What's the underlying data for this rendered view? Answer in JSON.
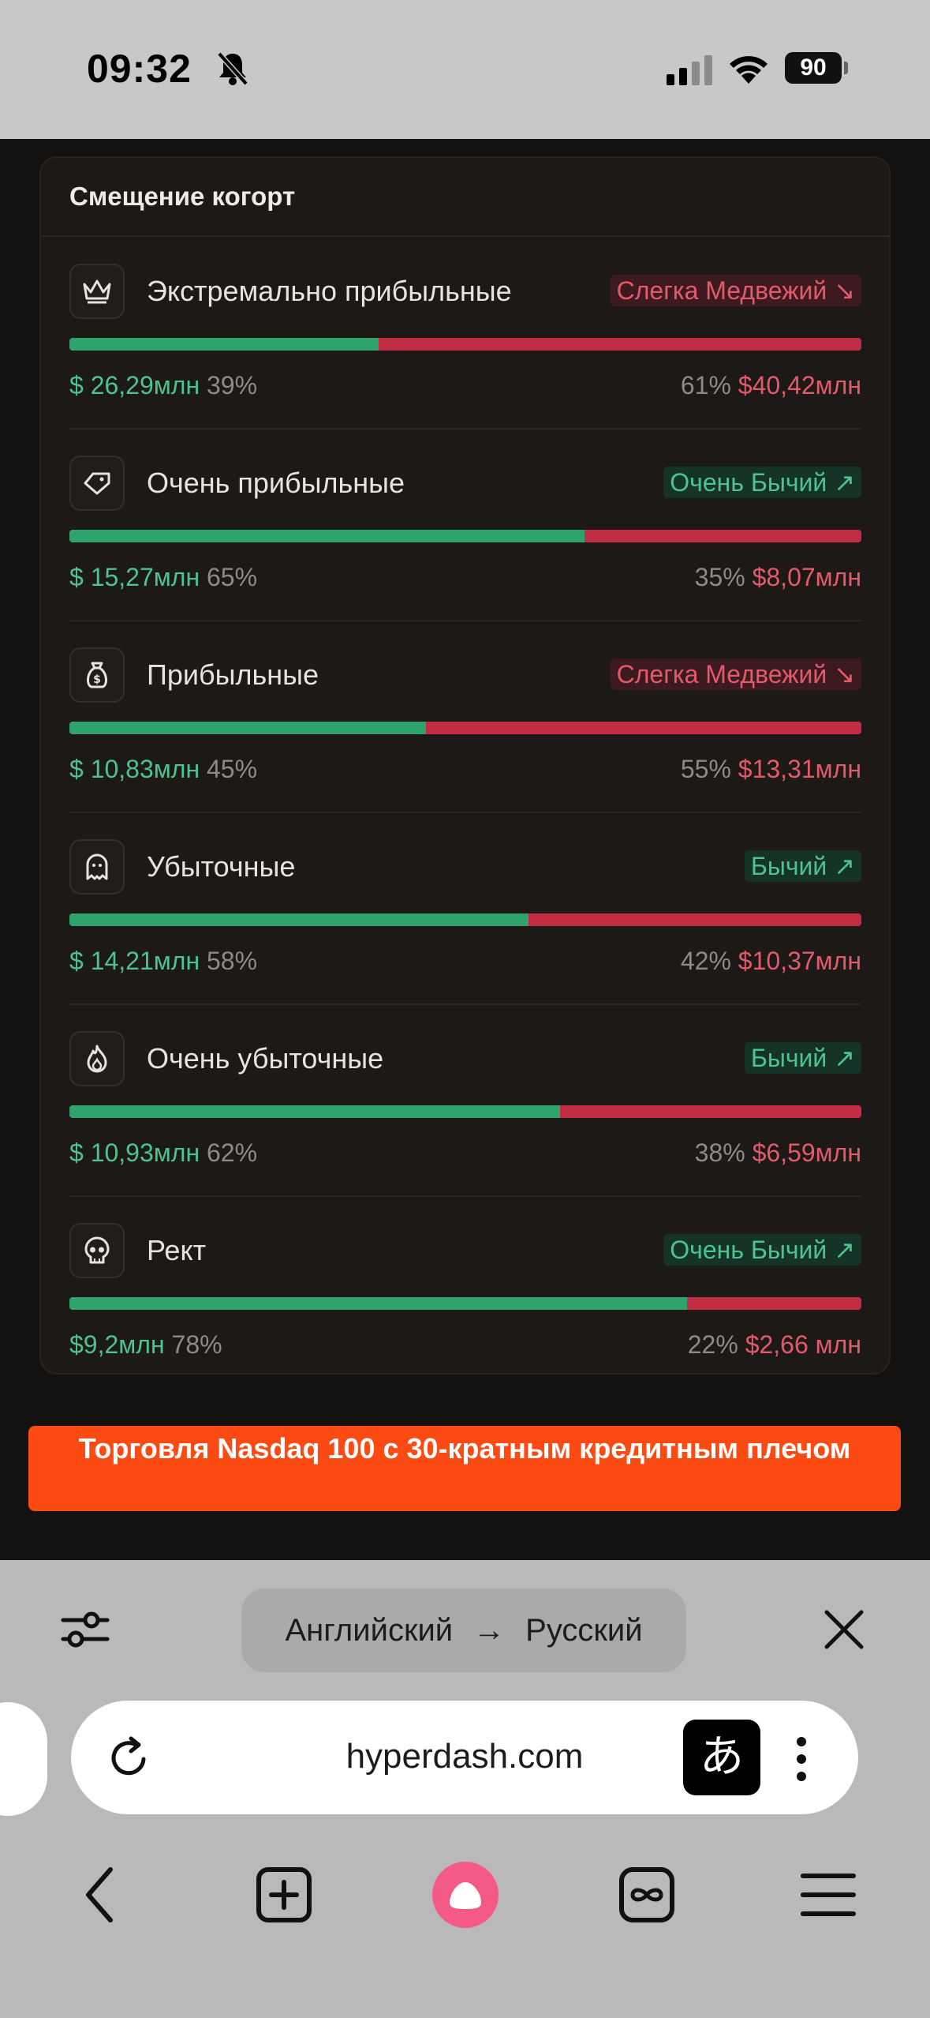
{
  "status_bar": {
    "time": "09:32",
    "battery": "90",
    "icons": [
      "bell-slash-icon",
      "signal-icon",
      "wifi-icon",
      "battery-icon"
    ]
  },
  "card": {
    "title": "Смещение когорт",
    "cohorts": [
      {
        "name": "Экстремально прибыльные",
        "icon": "crown-icon",
        "badge": "Слегка Медвежий ↘",
        "sentiment": "bear",
        "long_value": "$ 26,29млн",
        "long_pct": "39%",
        "short_pct": "61%",
        "short_value": "$40,42млн",
        "long_share": 0.39
      },
      {
        "name": "Очень прибыльные",
        "icon": "gem-icon",
        "badge": "Очень Бычий ↗",
        "sentiment": "bull",
        "long_value": "$ 15,27млн",
        "long_pct": "65%",
        "short_pct": "35%",
        "short_value": "$8,07млн",
        "long_share": 0.65
      },
      {
        "name": "Прибыльные",
        "icon": "money-bag-icon",
        "badge": "Слегка Медвежий ↘",
        "sentiment": "bear",
        "long_value": "$ 10,83млн",
        "long_pct": "45%",
        "short_pct": "55%",
        "short_value": "$13,31млн",
        "long_share": 0.45
      },
      {
        "name": "Убыточные",
        "icon": "ghost-icon",
        "badge": "Бычий ↗",
        "sentiment": "bull",
        "long_value": "$ 14,21млн",
        "long_pct": "58%",
        "short_pct": "42%",
        "short_value": "$10,37млн",
        "long_share": 0.58
      },
      {
        "name": "Очень убыточные",
        "icon": "flame-icon",
        "badge": "Бычий ↗",
        "sentiment": "bull",
        "long_value": "$ 10,93млн",
        "long_pct": "62%",
        "short_pct": "38%",
        "short_value": "$6,59млн",
        "long_share": 0.62
      },
      {
        "name": "Рект",
        "icon": "skull-icon",
        "badge": "Очень Бычий ↗",
        "sentiment": "bull",
        "long_value": "$9,2млн",
        "long_pct": "78%",
        "short_pct": "22%",
        "short_value": "$2,66 млн",
        "long_share": 0.78
      }
    ]
  },
  "promo": {
    "text": "Торговля Nasdaq 100 с 30-кратным кредитным плечом"
  },
  "translate_bar": {
    "from": "Английский",
    "arrow": "→",
    "to": "Русский"
  },
  "url_bar": {
    "url": "hyperdash.com",
    "translate_glyph": "あ"
  },
  "colors": {
    "green": "#2fa36c",
    "red": "#c22c44",
    "promo": "#fc4a13",
    "bg": "#141210"
  }
}
